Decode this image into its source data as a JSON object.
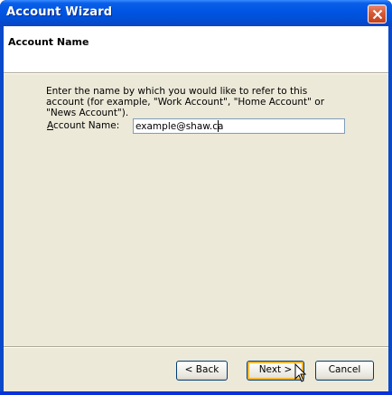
{
  "window": {
    "title": "Account Wizard"
  },
  "header": {
    "title": "Account Name"
  },
  "body": {
    "description": "Enter the name by which you would like to refer to this account (for example, \"Work Account\", \"Home Account\" or \"News Account\").",
    "account_name_label_accel": "A",
    "account_name_label_rest": "ccount Name:",
    "account_name_value": "example@shaw.ca"
  },
  "buttons": {
    "back": "< Back",
    "next": "Next >",
    "cancel": "Cancel"
  },
  "icons": {
    "close": "close-icon",
    "cursor": "mouse-pointer-icon"
  }
}
